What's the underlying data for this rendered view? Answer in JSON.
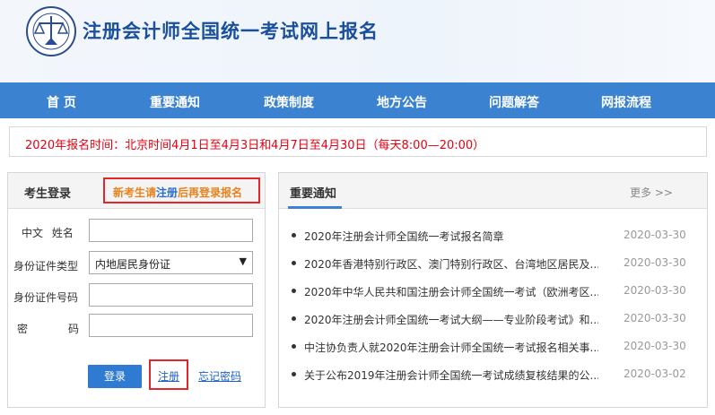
{
  "site": {
    "title": "注册会计师全国统一考试网上报名",
    "logo_icon": "cicpa-scales-logo-icon"
  },
  "nav": {
    "items": [
      "首 页",
      "重要通知",
      "政策制度",
      "地方公告",
      "问题解答",
      "网报流程"
    ]
  },
  "notice": {
    "text": "2020年报名时间：北京时间4月1日至4月3日和4月7日至4月30日（每天8:00—20:00）"
  },
  "login": {
    "title": "考生登录",
    "tip_prefix": "新考生请",
    "tip_link": "注册",
    "tip_suffix": "后再登录报名",
    "fields": {
      "name_label": "中文  姓名",
      "id_type_label": "身份证件类型",
      "id_type_value": "内地居民身份证",
      "id_number_label": "身份证件号码",
      "password_label_1": "密",
      "password_label_2": "码"
    },
    "login_button": "登录",
    "register_link": "注册",
    "forgot_link": "忘记密码"
  },
  "news": {
    "title": "重要通知",
    "more": "更多 >>",
    "items": [
      {
        "title": "2020年注册会计师全国统一考试报名简章",
        "date": "2020-03-30"
      },
      {
        "title": "2020年香港特别行政区、澳门特别行政区、台湾地区居民及...",
        "date": "2020-03-30"
      },
      {
        "title": "2020年中华人民共和国注册会计师全国统一考试（欧洲考区...",
        "date": "2020-03-30"
      },
      {
        "title": "2020年注册会计师全国统一考试大纲——专业阶段考试》和...",
        "date": "2020-03-30"
      },
      {
        "title": "中注协负责人就2020年注册会计师全国统一考试报名相关事...",
        "date": "2020-03-30"
      },
      {
        "title": "关于公布2019年注册会计师全国统一考试成绩复核结果的公...",
        "date": "2020-03-02"
      }
    ]
  },
  "colors": {
    "nav_bg": "#3b83d0",
    "title": "#1a4f9c",
    "notice_red": "#e60012",
    "tip_orange": "#e8821e",
    "highlight_red": "#e3262b"
  }
}
